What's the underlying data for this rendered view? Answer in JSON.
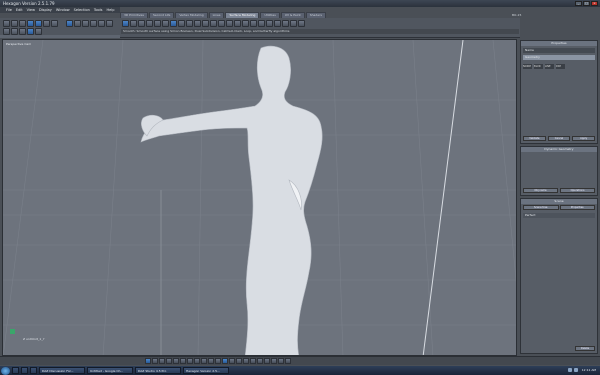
{
  "window": {
    "title": "Hexagon Version 2.5.1.79"
  },
  "menu": [
    "File",
    "Edit",
    "View",
    "Display",
    "Window",
    "Selection",
    "Tools",
    "Help"
  ],
  "tabs": [
    {
      "label": "3D Primitives",
      "active": false
    },
    {
      "label": "Second Life",
      "active": false
    },
    {
      "label": "Vertex Modeling",
      "active": false
    },
    {
      "label": "Lines",
      "active": false
    },
    {
      "label": "Surface Modeling",
      "active": true
    },
    {
      "label": "Utilities",
      "active": false
    },
    {
      "label": "UV & Paint",
      "active": false
    },
    {
      "label": "Shaders",
      "active": false
    }
  ],
  "version_label": "BO-15",
  "tooltip": "Smooth: Smooth surface using Simon Boolean, Dual Subdivision, Catmull-Clark, Loop, and butterfly algorithms",
  "viewport": {
    "label": "Perspective Cam",
    "axis_label": "Z unitUnit_1_?"
  },
  "properties": {
    "title": "Properties",
    "name_label": "Name",
    "geometry_label": "Geometry",
    "swatches": [
      "NORM",
      "BLUR",
      "LINE",
      "DIM"
    ],
    "buttons": [
      "Validate",
      "Cancel",
      "Apply"
    ]
  },
  "dynamic_geometry": {
    "title": "Dynamic Geometry",
    "tabs": [
      "Obj name",
      "Operations",
      ""
    ]
  },
  "scene": {
    "title": "Scene",
    "tabs": [
      "Scene tree",
      "Properties"
    ],
    "items": [
      {
        "label": "Perfect",
        "selected": true
      }
    ],
    "button": "Delete"
  },
  "taskbar": {
    "items": [
      "DAZ Discussion For...",
      "Untitled - Google Ch...",
      "DAZ Studio 4.5 Pro",
      "Hexagon Version 2.5..."
    ],
    "clock": "12:11 AM"
  },
  "colors": {
    "accent": "#2f6fb8",
    "viewport": "#6d737d",
    "panel": "#575d66"
  }
}
